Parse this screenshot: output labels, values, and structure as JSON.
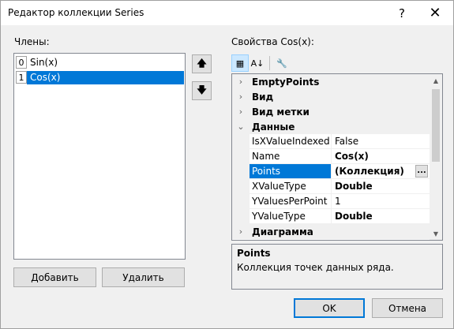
{
  "window": {
    "title": "Редактор коллекции Series",
    "help_label": "?",
    "close_label": "✕"
  },
  "members": {
    "label": "Члены:",
    "items": [
      {
        "index": "0",
        "name": "Sin(x)"
      },
      {
        "index": "1",
        "name": "Cos(x)"
      }
    ],
    "selected_index": 1,
    "up_icon": "arrow-up-icon",
    "down_icon": "arrow-down-icon",
    "up_glyph": "🡅",
    "down_glyph": "🡇"
  },
  "buttons": {
    "add": "Добавить",
    "remove": "Удалить",
    "ok": "OK",
    "cancel": "Отмена"
  },
  "properties": {
    "label": "Свойства Cos(x):",
    "toolbar": {
      "categorized_glyph": "▦",
      "alpha_glyph": "A↓",
      "pages_glyph": "🔧"
    },
    "rows": [
      {
        "kind": "category",
        "expander": "›",
        "name": "EmptyPoints"
      },
      {
        "kind": "category",
        "expander": "›",
        "name": "Вид"
      },
      {
        "kind": "category",
        "expander": "›",
        "name": "Вид метки"
      },
      {
        "kind": "category",
        "expander": "⌄",
        "name": "Данные"
      },
      {
        "kind": "prop",
        "name": "IsXValueIndexed",
        "value": "False",
        "bold": false
      },
      {
        "kind": "prop",
        "name": "Name",
        "value": "Cos(x)",
        "bold": true
      },
      {
        "kind": "prop",
        "name": "Points",
        "value": "(Коллекция)",
        "bold": true,
        "selected": true,
        "ellipsis": "..."
      },
      {
        "kind": "prop",
        "name": "XValueType",
        "value": "Double",
        "bold": true
      },
      {
        "kind": "prop",
        "name": "YValuesPerPoint",
        "value": "1",
        "bold": false
      },
      {
        "kind": "prop",
        "name": "YValueType",
        "value": "Double",
        "bold": true
      },
      {
        "kind": "category",
        "expander": "›",
        "name": "Диаграмма"
      }
    ],
    "help_title": "Points",
    "help_desc": "Коллекция точек данных ряда."
  },
  "colors": {
    "selection": "#0078d7",
    "window_bg": "#f0f0f0"
  }
}
